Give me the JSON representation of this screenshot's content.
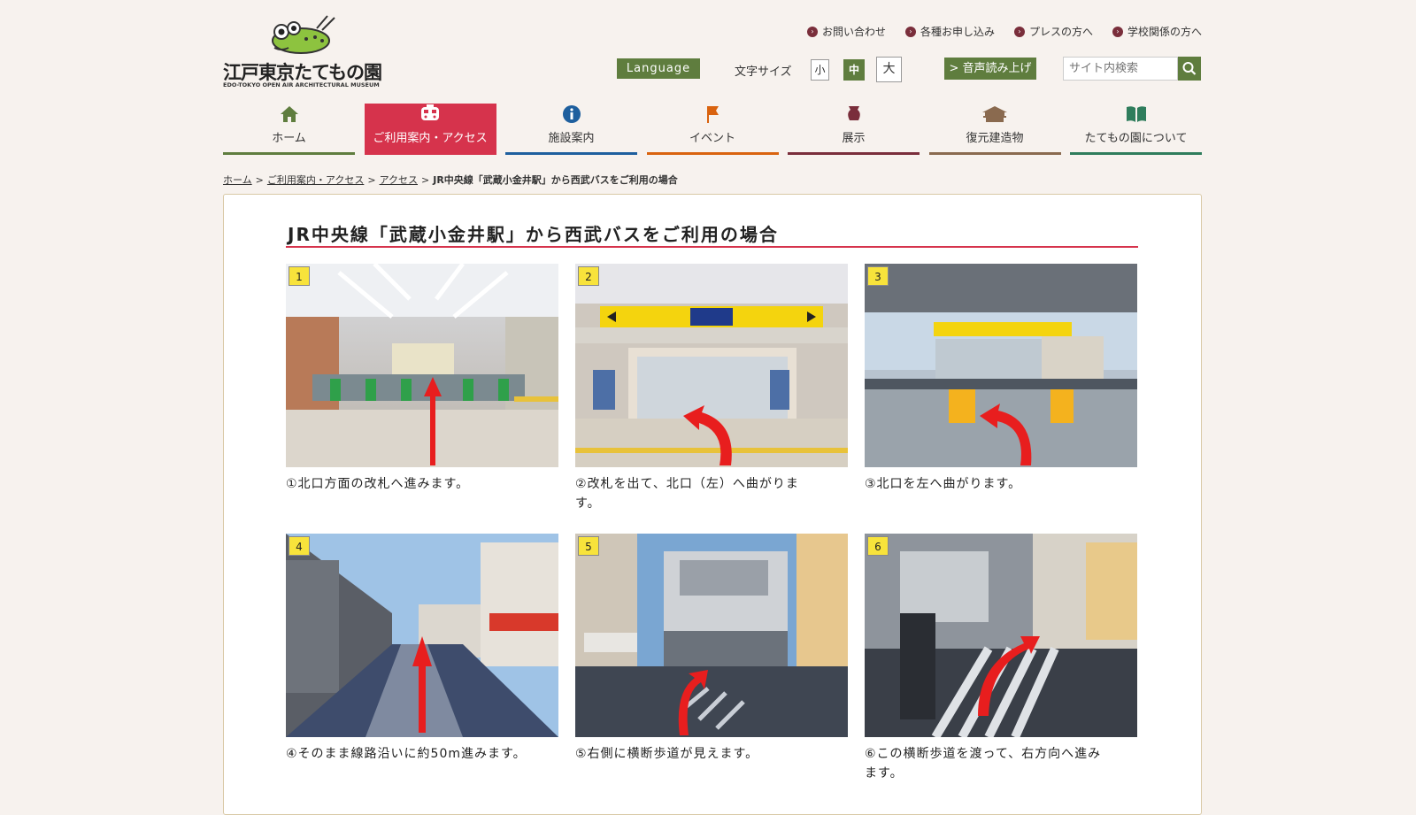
{
  "logo": {
    "title": "江戸東京たてもの園",
    "subtitle": "EDO-TOKYO OPEN AIR ARCHITECTURAL MUSEUM"
  },
  "top_links": [
    {
      "label": "お問い合わせ"
    },
    {
      "label": "各種お申し込み"
    },
    {
      "label": "プレスの方へ"
    },
    {
      "label": "学校関係の方へ"
    }
  ],
  "tools": {
    "language": "Language",
    "font_size_label": "文字サイズ",
    "font_small": "小",
    "font_mid": "中",
    "font_large": "大",
    "voice": "音声読み上げ",
    "search_placeholder": "サイト内検索"
  },
  "nav": [
    {
      "label": "ホーム",
      "icon": "home-icon",
      "color": "#5f7d3e"
    },
    {
      "label": "ご利用案内・アクセス",
      "icon": "train-icon",
      "color": "#d6334c",
      "active": true
    },
    {
      "label": "施設案内",
      "icon": "info-icon",
      "color": "#1e5f9e"
    },
    {
      "label": "イベント",
      "icon": "flag-icon",
      "color": "#d9630f"
    },
    {
      "label": "展示",
      "icon": "vase-icon",
      "color": "#7a2e3b"
    },
    {
      "label": "復元建造物",
      "icon": "building-icon",
      "color": "#8a6a4f"
    },
    {
      "label": "たてもの園について",
      "icon": "book-icon",
      "color": "#2f7d5c"
    }
  ],
  "breadcrumb": {
    "home": "ホーム",
    "guide": "ご利用案内・アクセス",
    "access": "アクセス",
    "current": "JR中央線「武蔵小金井駅」から西武バスをご利用の場合"
  },
  "page_title": "JR中央線「武蔵小金井駅」から西武バスをご利用の場合",
  "steps": [
    {
      "num": "1",
      "caption": "①北口方面の改札へ進みます。"
    },
    {
      "num": "2",
      "caption": "②改札を出て、北口（左）へ曲がりま\nす。"
    },
    {
      "num": "3",
      "caption": "③北口を左へ曲がります。"
    },
    {
      "num": "4",
      "caption": "④そのまま線路沿いに約50m進みます。"
    },
    {
      "num": "5",
      "caption": "⑤右側に横断歩道が見えます。"
    },
    {
      "num": "6",
      "caption": "⑥この横断歩道を渡って、右方向へ進み\nます。"
    }
  ]
}
